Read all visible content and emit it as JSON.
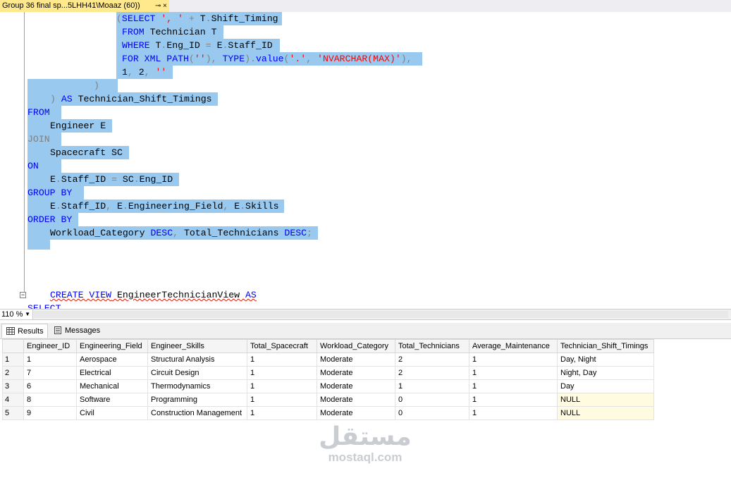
{
  "tab": {
    "title": "Group 36 final  sp...5LHH41\\Moaaz (60))",
    "pin": "⊸",
    "close": "×"
  },
  "code": {
    "l1_a": "(",
    "l1_b": "SELECT",
    "l1_c": " ', '",
    "l1_d": " + ",
    "l1_e": "T",
    "l1_f": ".",
    "l1_g": "Shift_Timing",
    "l2_a": "FROM",
    "l2_b": " Technician T",
    "l3_a": "WHERE",
    "l3_b": " T",
    "l3_c": ".",
    "l3_d": "Eng_ID",
    "l3_e": " = ",
    "l3_f": "E",
    "l3_g": ".",
    "l3_h": "Staff_ID",
    "l4_a": "FOR XML PATH",
    "l4_b": "(",
    "l4_c": "''",
    "l4_d": "),",
    "l4_e": " TYPE",
    "l4_f": ").",
    "l4_g": "value",
    "l4_h": "(",
    "l4_i": "'.'",
    "l4_j": ", ",
    "l4_k": "'NVARCHAR(MAX)'",
    "l4_l": "),",
    "l5_a": "1",
    "l5_b": ", ",
    "l5_c": "2",
    "l5_d": ", ",
    "l5_e": "''",
    "l6_a": ")",
    "l7_a": ")",
    "l7_b": " AS",
    "l7_c": " Technician_Shift_Timings",
    "l8_a": "FROM",
    "l9_a": "Engineer E",
    "l10_a": "JOIN",
    "l11_a": "Spacecraft SC",
    "l12_a": "ON",
    "l13_a": "E",
    "l13_b": ".",
    "l13_c": "Staff_ID",
    "l13_d": " = ",
    "l13_e": "SC",
    "l13_f": ".",
    "l13_g": "Eng_ID",
    "l14_a": "GROUP BY",
    "l15_a": "E",
    "l15_b": ".",
    "l15_c": "Staff_ID",
    "l15_d": ", ",
    "l15_e": "E",
    "l15_f": ".",
    "l15_g": "Engineering_Field",
    "l15_h": ", ",
    "l15_i": "E",
    "l15_j": ".",
    "l15_k": "Skills",
    "l16_a": "ORDER BY",
    "l17_a": "Workload_Category",
    "l17_b": " DESC",
    "l17_c": ", ",
    "l17_d": "Total_Technicians",
    "l17_e": " DESC",
    "l17_f": ";",
    "l18_a": "CREATE VIEW",
    "l18_b": " EngineerTechnicianView",
    "l18_c": " AS",
    "l19_a": "SELECT",
    "collapse_glyph": "−"
  },
  "zoom": {
    "value": "110 %",
    "arrow": "▼"
  },
  "results_tabs": [
    {
      "label": "Results",
      "icon": "grid-icon"
    },
    {
      "label": "Messages",
      "icon": "messages-icon"
    }
  ],
  "grid": {
    "columns": [
      "Engineer_ID",
      "Engineering_Field",
      "Engineer_Skills",
      "Total_Spacecraft",
      "Workload_Category",
      "Total_Technicians",
      "Average_Maintenance",
      "Technician_Shift_Timings"
    ],
    "rows": [
      {
        "n": "1",
        "cells": [
          "1",
          "Aerospace",
          "Structural Analysis",
          "1",
          "Moderate",
          "2",
          "1",
          "Day, Night"
        ]
      },
      {
        "n": "2",
        "cells": [
          "7",
          "Electrical",
          "Circuit Design",
          "1",
          "Moderate",
          "2",
          "1",
          "Night, Day"
        ]
      },
      {
        "n": "3",
        "cells": [
          "6",
          "Mechanical",
          "Thermodynamics",
          "1",
          "Moderate",
          "1",
          "1",
          "Day"
        ]
      },
      {
        "n": "4",
        "cells": [
          "8",
          "Software",
          "Programming",
          "1",
          "Moderate",
          "0",
          "1",
          "NULL"
        ]
      },
      {
        "n": "5",
        "cells": [
          "9",
          "Civil",
          "Construction Management",
          "1",
          "Moderate",
          "0",
          "1",
          "NULL"
        ]
      }
    ]
  },
  "watermark": {
    "arabic": "مستقل",
    "latin": "mostaql.com"
  },
  "colors": {
    "keyword": "#0000ff",
    "string": "#ff0000",
    "selection": "#99c9ef",
    "tab_active": "#ffe98c",
    "null_cell": "#fffbe1"
  }
}
